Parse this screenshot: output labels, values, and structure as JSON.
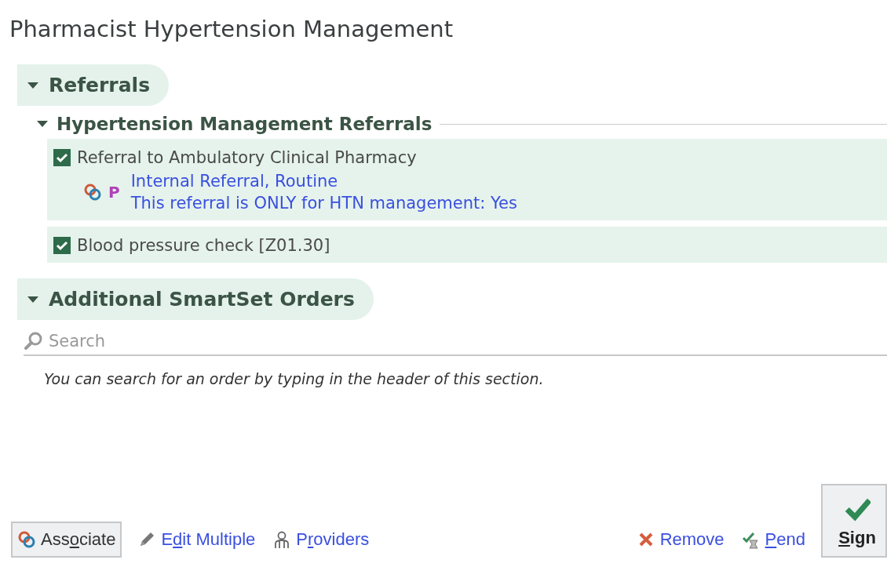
{
  "title": "Pharmacist Hypertension Management",
  "sections": [
    {
      "kind": "orders",
      "label": "Referrals",
      "expanded": true,
      "groups": [
        {
          "label": "Hypertension Management Referrals",
          "expanded": true,
          "orders": [
            {
              "label": "Referral to Ambulatory Clinical Pharmacy",
              "checked": true,
              "linked": true,
              "badge": "P",
              "details": [
                "Internal Referral, Routine",
                "This referral is ONLY for HTN management: Yes"
              ]
            },
            {
              "label": "Blood pressure check [Z01.30]",
              "checked": true
            }
          ]
        }
      ]
    },
    {
      "kind": "search",
      "label": "Additional SmartSet Orders",
      "expanded": true,
      "search": {
        "placeholder": "Search"
      },
      "hint": "You can search for an order by typing in the header of this section."
    }
  ],
  "toolbar": [
    {
      "kind": "associate",
      "before": "Ass",
      "key": "o",
      "after": "ciate"
    },
    {
      "kind": "edit",
      "before": "E",
      "key": "d",
      "after": "it Multiple"
    },
    {
      "kind": "providers",
      "before": "P",
      "key": "r",
      "after": "oviders"
    },
    {
      "kind": "remove",
      "before": "Remove"
    },
    {
      "kind": "pend",
      "key": "P",
      "after": "end"
    },
    {
      "kind": "sign",
      "key": "S",
      "after": "ign"
    }
  ]
}
